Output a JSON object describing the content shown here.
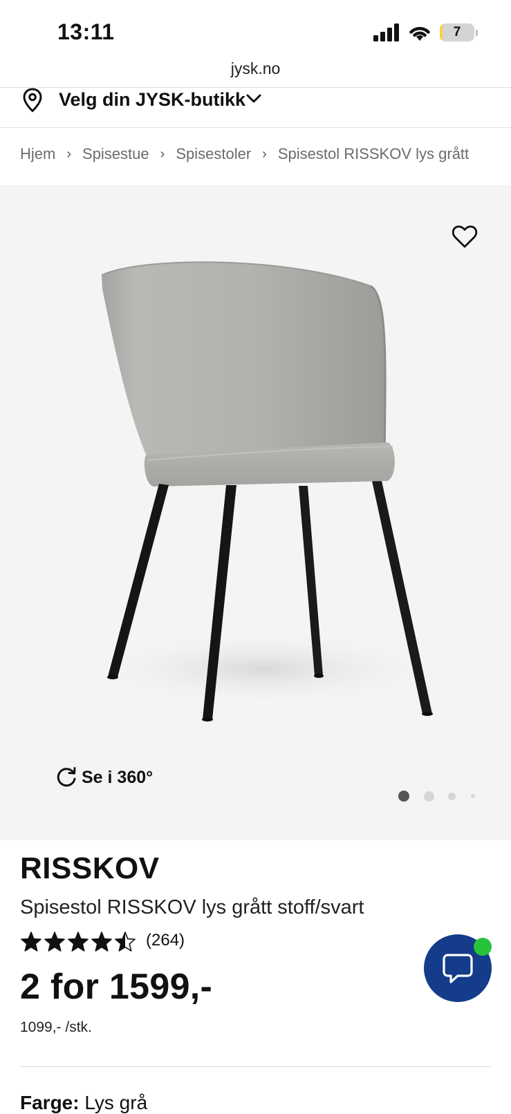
{
  "status_bar": {
    "time": "13:11",
    "battery_level": "7",
    "battery_fill_fraction": 0.07,
    "icons": [
      "signal-icon",
      "wifi-icon",
      "battery-icon"
    ]
  },
  "browser": {
    "url": "jysk.no"
  },
  "store_selector": {
    "label": "Velg din JYSK-butikk",
    "icon": "location-pin-icon"
  },
  "breadcrumb": {
    "items": [
      "Hjem",
      "Spisestue",
      "Spisestoler",
      "Spisestol RISSKOV lys grått"
    ],
    "separator": "›"
  },
  "gallery": {
    "view360_label": "Se i 360°",
    "image_count": 4,
    "active_index": 0,
    "background": "#f4f4f4"
  },
  "product": {
    "brand": "RISSKOV",
    "name": "Spisestol RISSKOV lys grått stoff/svart",
    "rating": 4.5,
    "rating_max": 5,
    "review_count": "(264)",
    "price": "2 for 1599,-",
    "unit_price": "1099,- /stk.",
    "color_label": "Farge:",
    "color_value": "Lys grå"
  },
  "chat": {
    "accent": "#143c8a",
    "online_color": "#26c33a"
  }
}
